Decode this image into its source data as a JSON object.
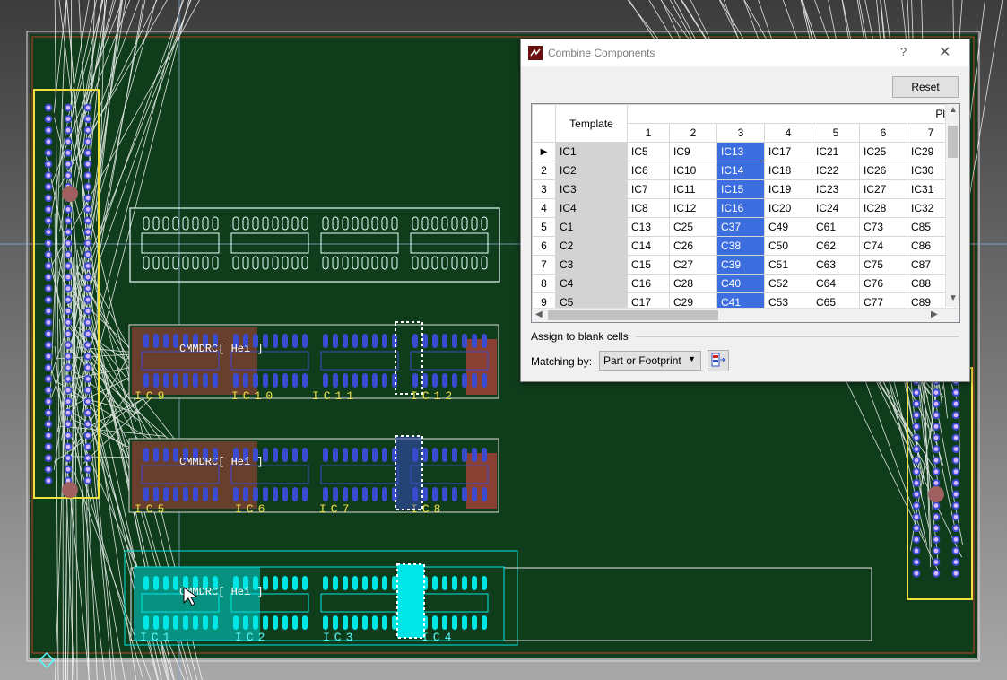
{
  "board": {
    "silkscreen": {
      "row1": [
        "IC9",
        "IC10",
        "IC11",
        "IC12"
      ],
      "row2": [
        "IC5",
        "IC6",
        "IC7",
        "IC8"
      ],
      "row3": [
        "IC1",
        "IC2",
        "IC3",
        "IC4"
      ]
    },
    "designator_fragments": [
      "CMMDRC[ Hei ]",
      "CMMDRC[ Hei ]",
      "CMMDRC[ Hei ]"
    ],
    "colors": {
      "board": "#0f3d1c",
      "selection": "#00e5e5",
      "silkscreen": "#f0e040",
      "copper": "#3b4bd0",
      "keepout": "#c0402a"
    }
  },
  "dialog": {
    "title": "Combine Components",
    "help": "?",
    "close": "✕",
    "reset_label": "Reset",
    "grid": {
      "header_template": "Template",
      "header_group": "Pl",
      "columns": [
        "1",
        "2",
        "3",
        "4",
        "5",
        "6",
        "7"
      ],
      "selected_column": 3,
      "rows": [
        {
          "n": "",
          "tmpl": "IC1",
          "cells": [
            "IC5",
            "IC9",
            "IC13",
            "IC17",
            "IC21",
            "IC25",
            "IC29"
          ]
        },
        {
          "n": "2",
          "tmpl": "IC2",
          "cells": [
            "IC6",
            "IC10",
            "IC14",
            "IC18",
            "IC22",
            "IC26",
            "IC30"
          ]
        },
        {
          "n": "3",
          "tmpl": "IC3",
          "cells": [
            "IC7",
            "IC11",
            "IC15",
            "IC19",
            "IC23",
            "IC27",
            "IC31"
          ]
        },
        {
          "n": "4",
          "tmpl": "IC4",
          "cells": [
            "IC8",
            "IC12",
            "IC16",
            "IC20",
            "IC24",
            "IC28",
            "IC32"
          ]
        },
        {
          "n": "5",
          "tmpl": "C1",
          "cells": [
            "C13",
            "C25",
            "C37",
            "C49",
            "C61",
            "C73",
            "C85"
          ]
        },
        {
          "n": "6",
          "tmpl": "C2",
          "cells": [
            "C14",
            "C26",
            "C38",
            "C50",
            "C62",
            "C74",
            "C86"
          ]
        },
        {
          "n": "7",
          "tmpl": "C3",
          "cells": [
            "C15",
            "C27",
            "C39",
            "C51",
            "C63",
            "C75",
            "C87"
          ]
        },
        {
          "n": "8",
          "tmpl": "C4",
          "cells": [
            "C16",
            "C28",
            "C40",
            "C52",
            "C64",
            "C76",
            "C88"
          ]
        },
        {
          "n": "9",
          "tmpl": "C5",
          "cells": [
            "C17",
            "C29",
            "C41",
            "C53",
            "C65",
            "C77",
            "C89"
          ]
        }
      ]
    },
    "assign_label": "Assign to blank cells",
    "matching_label": "Matching by:",
    "matching_value": "Part or Footprint"
  }
}
